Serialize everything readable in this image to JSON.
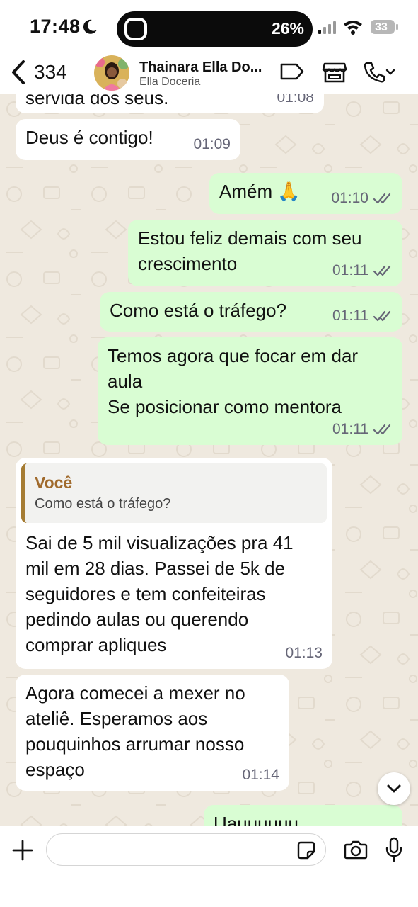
{
  "status_bar": {
    "time": "17:48",
    "island_percent": "26%",
    "battery_level": "33"
  },
  "header": {
    "back_count": "334",
    "contact_name": "Thainara Ella Do...",
    "contact_subtitle": "Ella Doceria"
  },
  "messages": [
    {
      "direction": "in",
      "text": "servida dos seus.",
      "time": "01:08"
    },
    {
      "direction": "in",
      "text": "Deus é contigo!",
      "time": "01:09"
    },
    {
      "direction": "out",
      "text": "Amém 🙏",
      "time": "01:10"
    },
    {
      "direction": "out",
      "text": "Estou feliz demais com seu\ncrescimento",
      "time": "01:11"
    },
    {
      "direction": "out",
      "text": "Como está o tráfego?",
      "time": "01:11"
    },
    {
      "direction": "out",
      "text": "Temos agora que focar em dar\naula\nSe posicionar como mentora",
      "time": "01:11"
    },
    {
      "direction": "in",
      "quote_author": "Você",
      "quote_text": "Como está o tráfego?",
      "text": "Sai de 5 mil visualizações pra 41\nmil em 28 dias. Passei de 5k de\nseguidores e tem confeiteiras\npedindo aulas ou querendo\ncomprar apliques",
      "time": "01:13"
    },
    {
      "direction": "in",
      "text": "Agora comecei a mexer no\nateliê. Esperamos aos\npouquinhos arrumar nosso\nespaço",
      "time": "01:14"
    },
    {
      "direction": "out",
      "text": "Uauuuuuu",
      "time": ""
    }
  ],
  "input": {
    "placeholder": ""
  },
  "icons": [
    "back-chevron-icon",
    "label-icon",
    "store-icon",
    "phone-icon",
    "chevron-down-icon",
    "plus-icon",
    "sticker-icon",
    "camera-icon",
    "microphone-icon",
    "read-receipt-icon"
  ],
  "colors": {
    "outgoing_bubble": "#d9fdd3",
    "incoming_bubble": "#ffffff",
    "chat_background": "#efe9df",
    "quote_author": "#a06a2c"
  }
}
